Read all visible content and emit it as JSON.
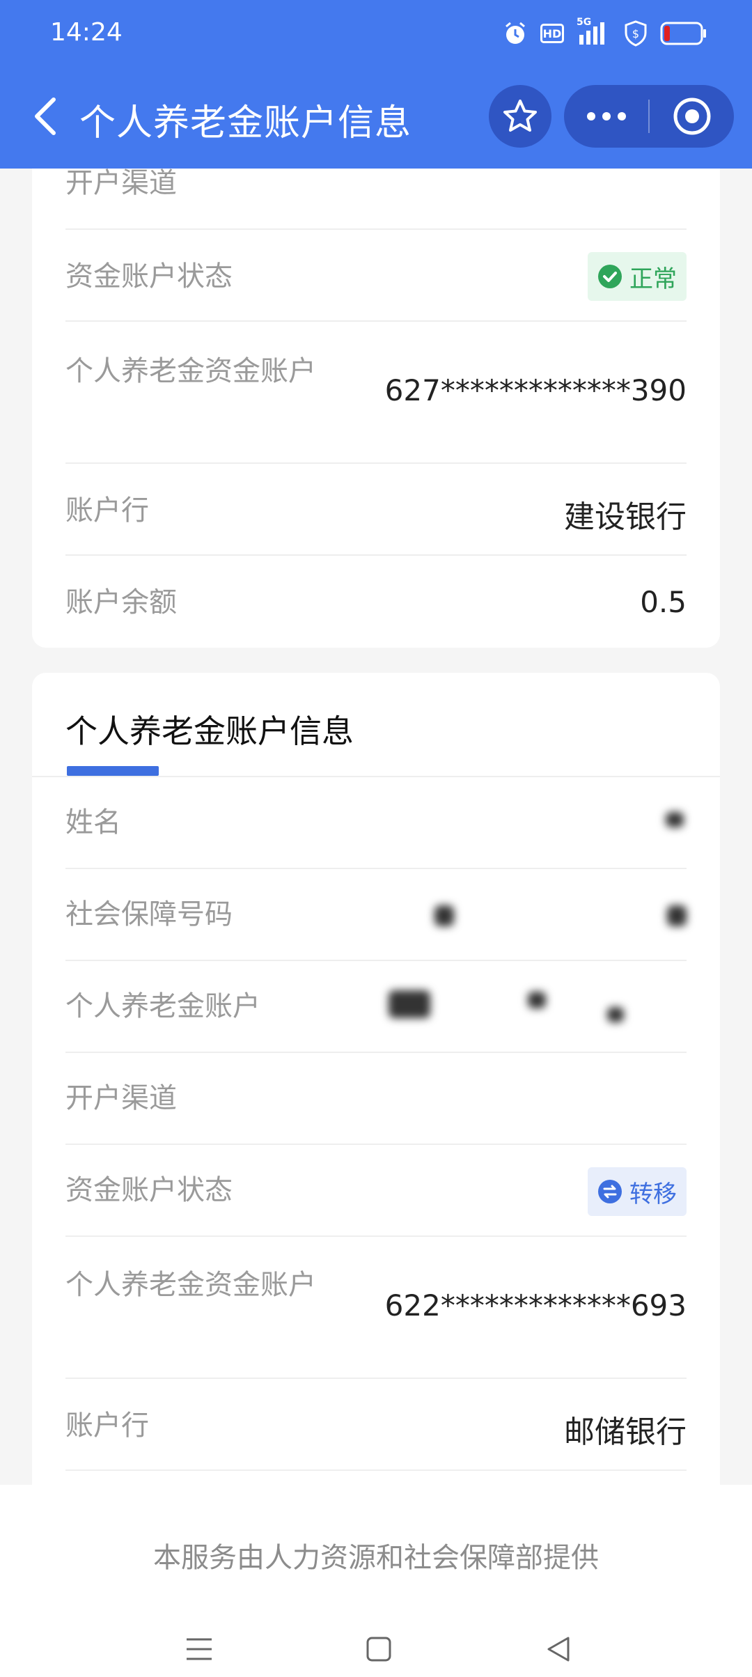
{
  "status": {
    "time": "14:24",
    "hd_label": "HD",
    "net_label": "5G"
  },
  "header": {
    "title": "个人养老金账户信息"
  },
  "card1": {
    "rows": [
      {
        "label": "开户渠道",
        "value": ""
      },
      {
        "label": "资金账户状态",
        "badge": "正常"
      },
      {
        "label": "个人养老金资金账户",
        "value": "627*************390"
      },
      {
        "label": "账户行",
        "value": "建设银行"
      },
      {
        "label": "账户余额",
        "value": "0.5"
      }
    ]
  },
  "card2": {
    "title": "个人养老金账户信息",
    "rows": [
      {
        "label": "姓名",
        "value": ""
      },
      {
        "label": "社会保障号码",
        "value": ""
      },
      {
        "label": "个人养老金账户",
        "value": ""
      },
      {
        "label": "开户渠道",
        "value": ""
      },
      {
        "label": "资金账户状态",
        "badge": "转移"
      },
      {
        "label": "个人养老金资金账户",
        "value": "622*************693"
      },
      {
        "label": "账户行",
        "value": "邮储银行"
      }
    ]
  },
  "footer": {
    "text": "本服务由人力资源和社会保障部提供"
  },
  "colors": {
    "header_bg": "#4479ee",
    "accent": "#3e6fe0",
    "ok_green": "#2fa55a"
  }
}
